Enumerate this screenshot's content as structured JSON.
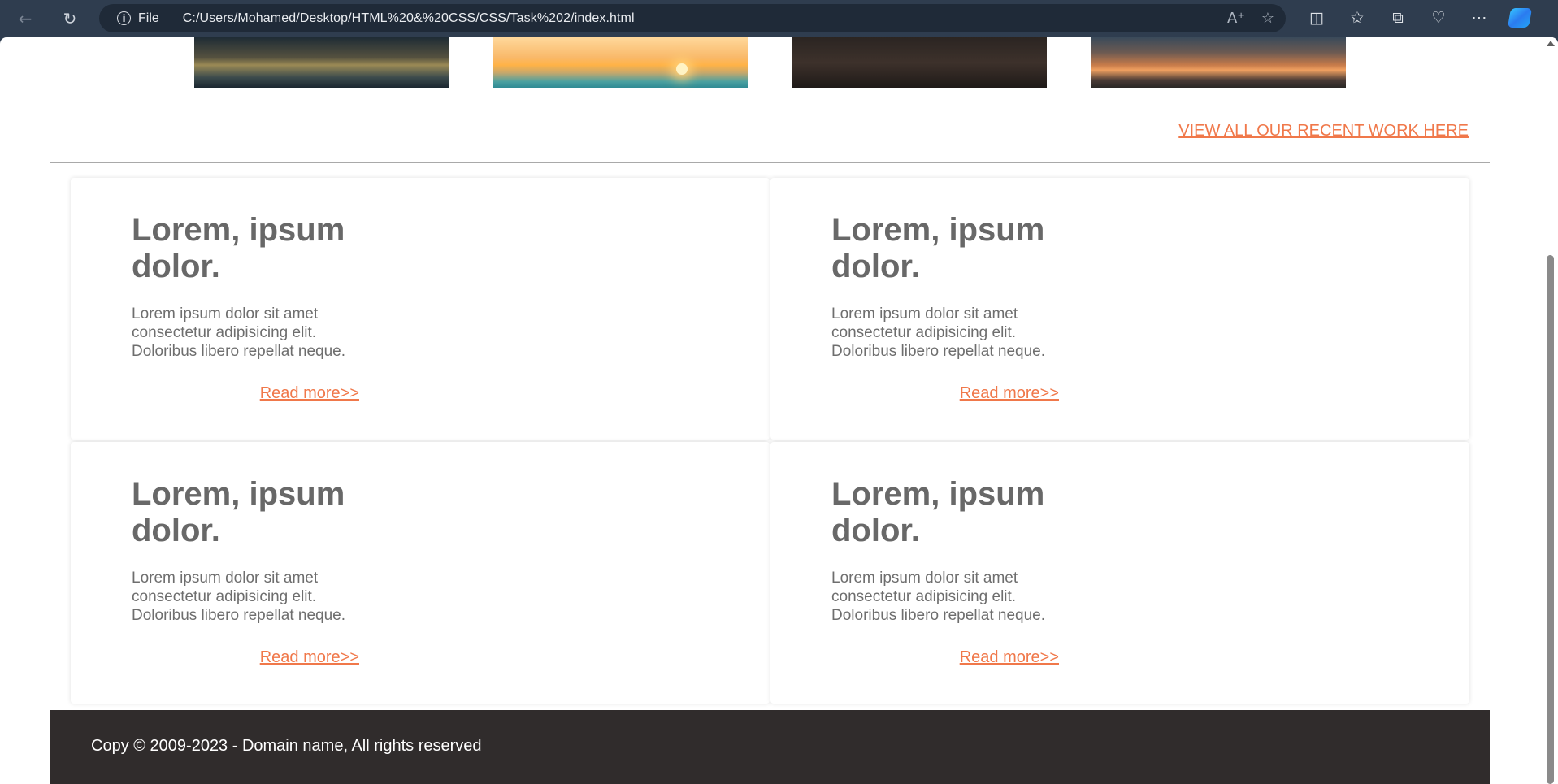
{
  "browser": {
    "address_scheme": "File",
    "url": "C:/Users/Mohamed/Desktop/HTML%20&%20CSS/CSS/Task%202/index.html"
  },
  "recent_work": {
    "link_label": "VIEW ALL OUR RECENT WORK HERE"
  },
  "cards": [
    {
      "title": "Lorem, ipsum dolor.",
      "text": "Lorem ipsum dolor sit amet consectetur adipisicing elit. Doloribus libero repellat neque.",
      "link": "Read more>>"
    },
    {
      "title": "Lorem, ipsum dolor.",
      "text": "Lorem ipsum dolor sit amet consectetur adipisicing elit. Doloribus libero repellat neque.",
      "link": "Read more>>"
    },
    {
      "title": "Lorem, ipsum dolor.",
      "text": "Lorem ipsum dolor sit amet consectetur adipisicing elit. Doloribus libero repellat neque.",
      "link": "Read more>>"
    },
    {
      "title": "Lorem, ipsum dolor.",
      "text": "Lorem ipsum dolor sit amet consectetur adipisicing elit. Doloribus libero repellat neque.",
      "link": "Read more>>"
    }
  ],
  "footer": {
    "copyright": "Copy © 2009-2023 - Domain name, All rights reserved"
  },
  "colors": {
    "accent_link": "#f0784a",
    "heading": "#686868",
    "footer_bg": "#302c2c",
    "chrome_bg": "#2f3d4f"
  },
  "icons": {
    "back": "arrow-left-icon",
    "refresh": "refresh-icon",
    "info": "info-icon",
    "read_aloud": "read-aloud-icon",
    "favorite": "star-icon",
    "split": "split-screen-icon",
    "favorites": "favorites-icon",
    "collections": "collections-icon",
    "health": "browser-essentials-icon",
    "more": "more-icon",
    "copilot": "copilot-icon"
  }
}
